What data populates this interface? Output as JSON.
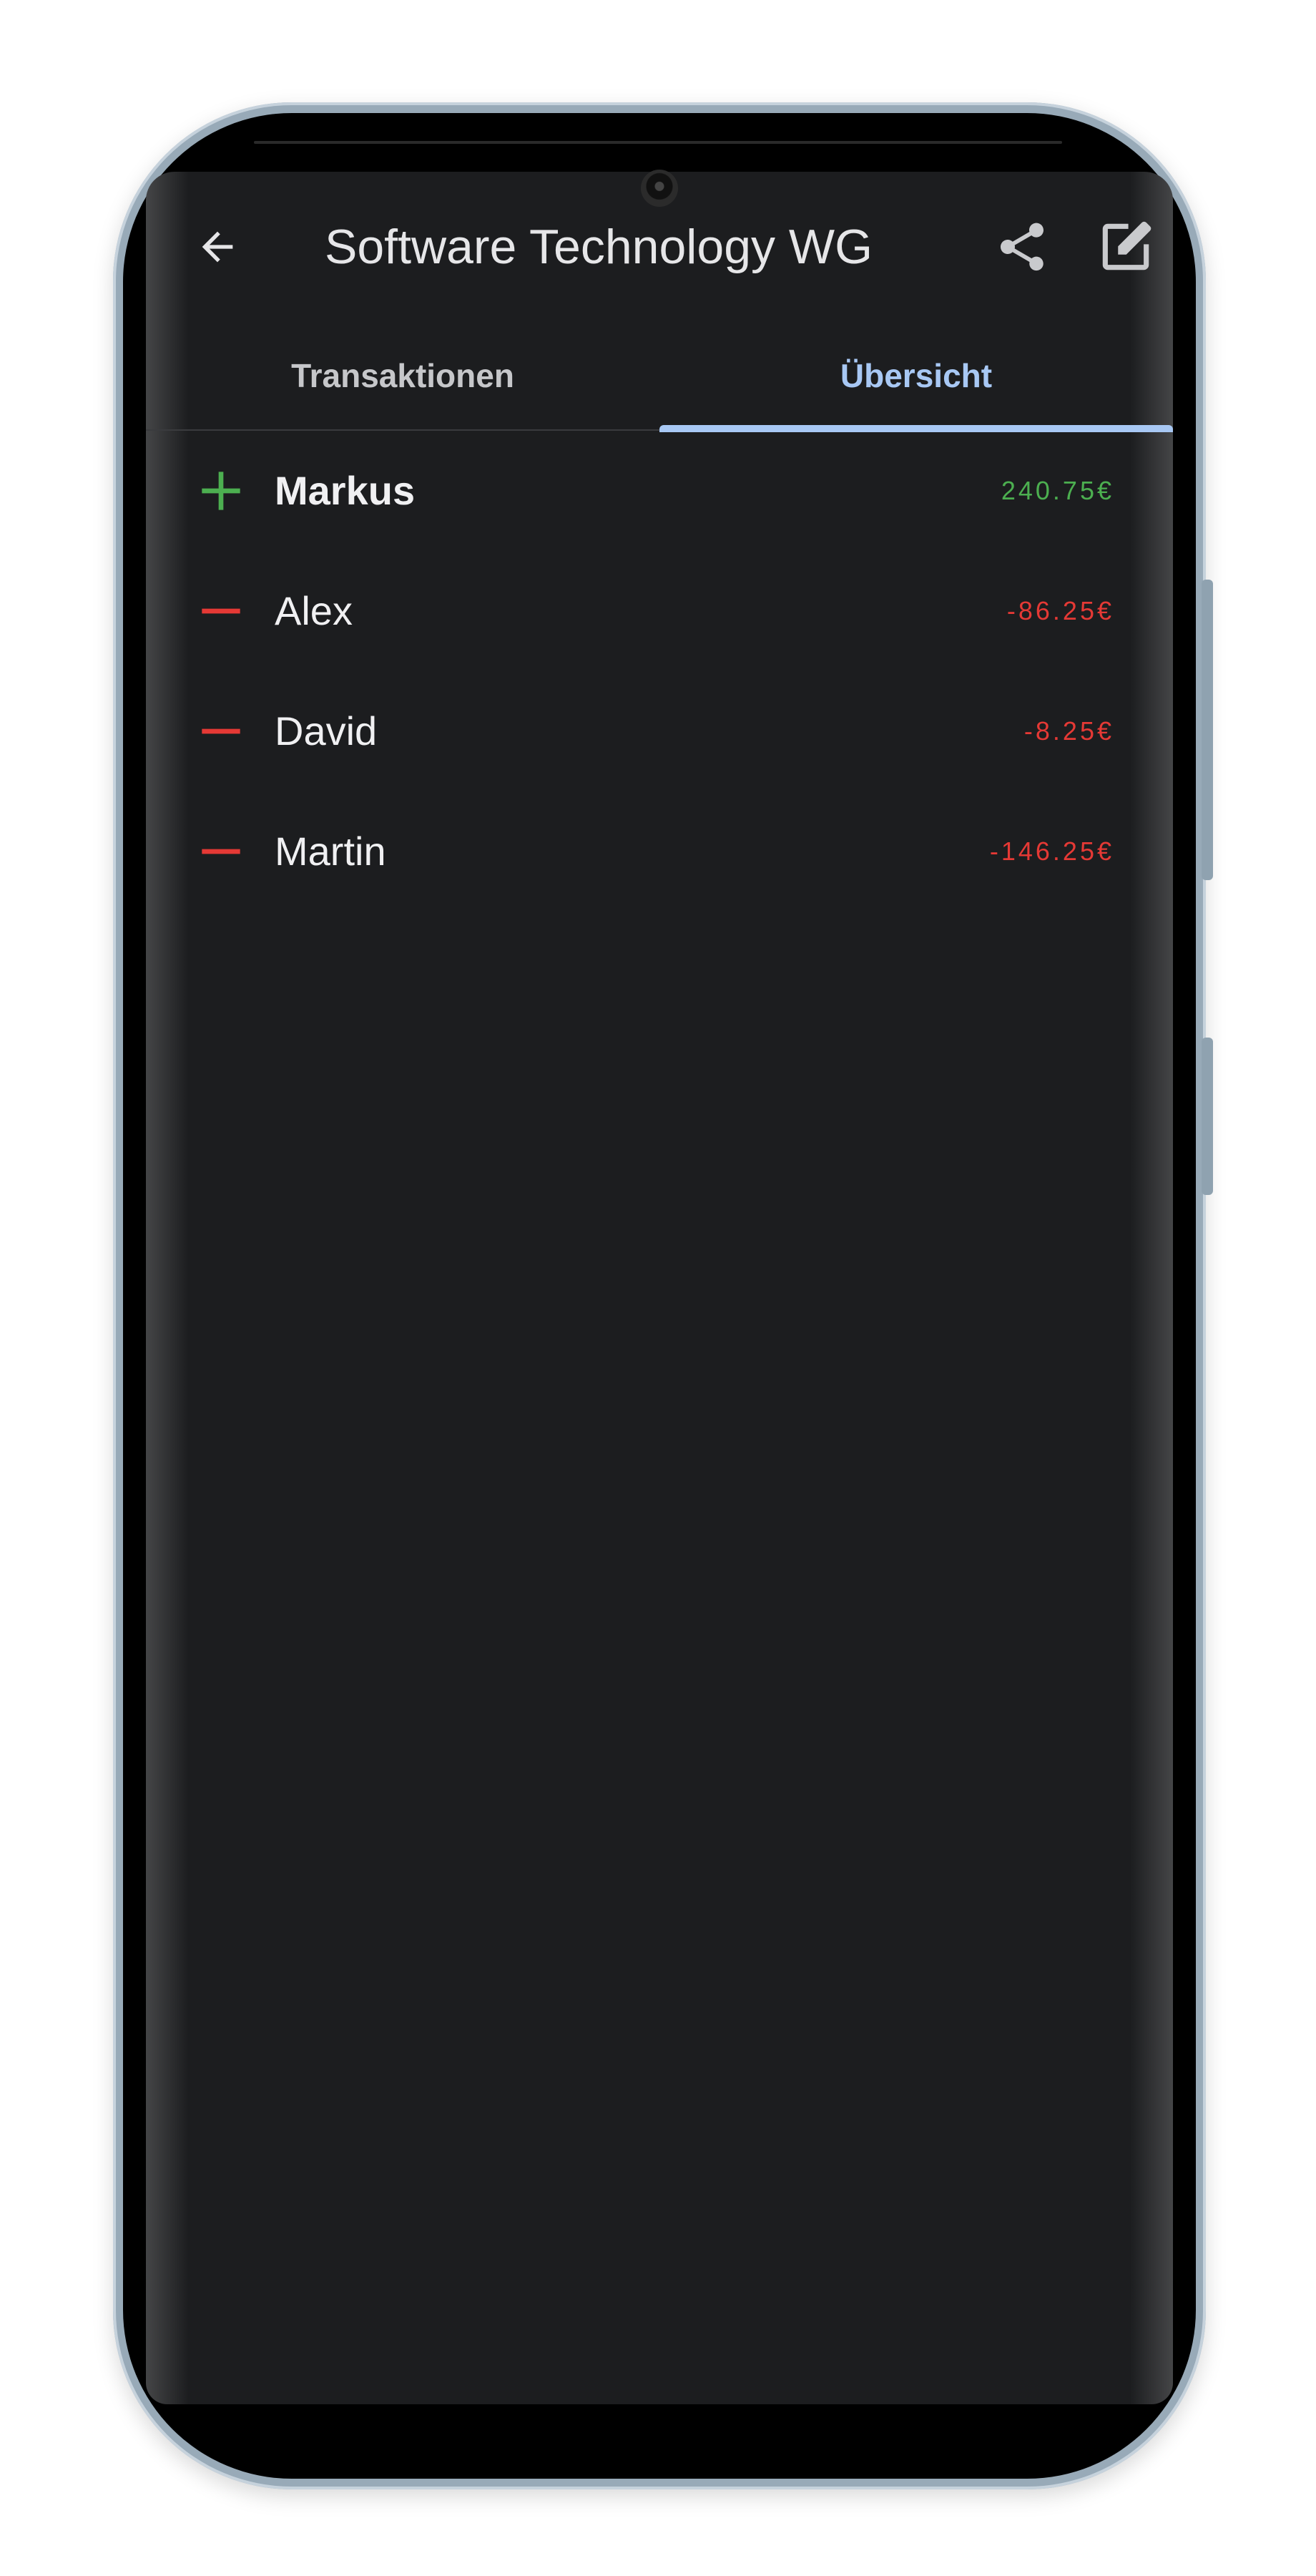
{
  "app": {
    "title": "Software Technology WG"
  },
  "tabs": [
    {
      "label": "Transaktionen",
      "selected": false
    },
    {
      "label": "Übersicht",
      "selected": true
    }
  ],
  "balances": [
    {
      "name": "Markus",
      "amount": "240.75€",
      "sign": "plus",
      "color": "#4caf50",
      "bold": true
    },
    {
      "name": "Alex",
      "amount": "-86.25€",
      "sign": "minus",
      "color": "#e53935",
      "bold": false
    },
    {
      "name": "David",
      "amount": "-8.25€",
      "sign": "minus",
      "color": "#e53935",
      "bold": false
    },
    {
      "name": "Martin",
      "amount": "-146.25€",
      "sign": "minus",
      "color": "#e53935",
      "bold": false
    }
  ],
  "colors": {
    "background": "#1c1d1f",
    "accent": "#a8c8f4",
    "positive": "#4caf50",
    "negative": "#e53935"
  },
  "icons": {
    "back": "arrow-back-icon",
    "share": "share-icon",
    "edit": "edit-icon"
  }
}
